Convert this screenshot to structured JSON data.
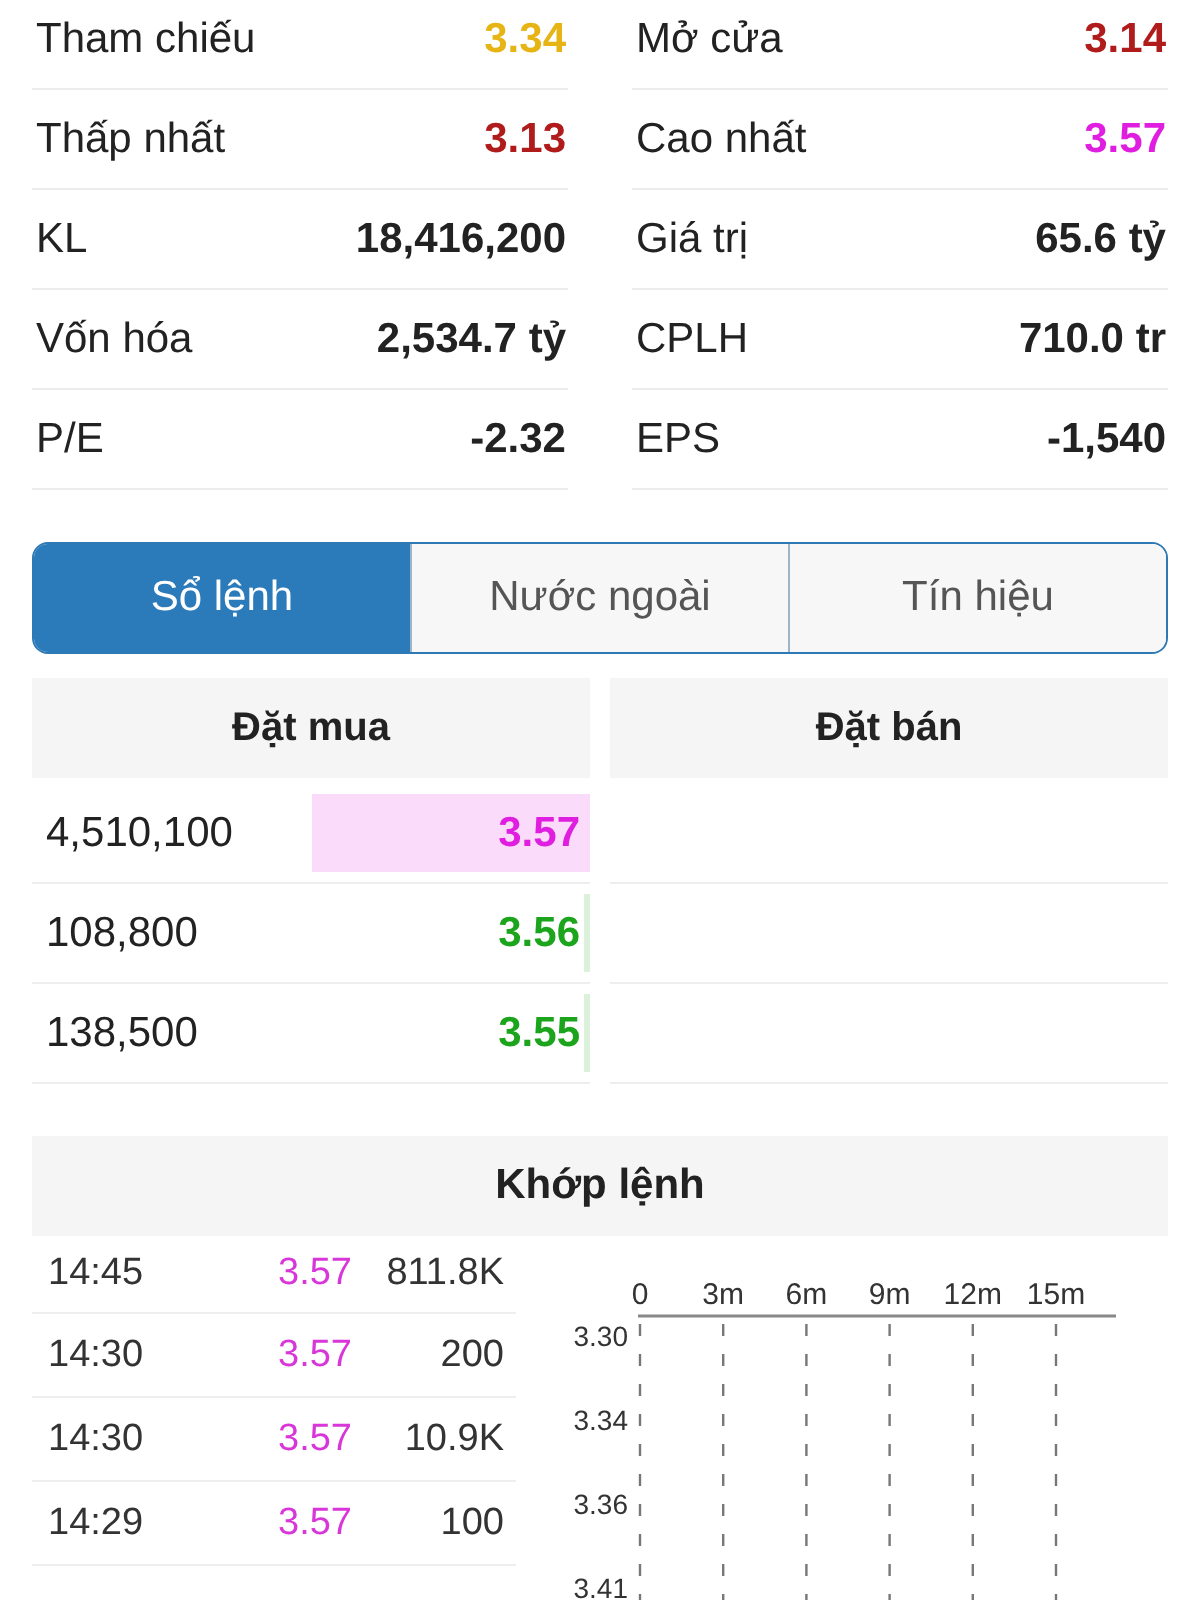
{
  "stats": [
    {
      "label": "Tham chiếu",
      "value": "3.34",
      "color": "#e6b414"
    },
    {
      "label": "Mở cửa",
      "value": "3.14",
      "color": "#b01c1c"
    },
    {
      "label": "Thấp nhất",
      "value": "3.13",
      "color": "#b01c1c"
    },
    {
      "label": "Cao nhất",
      "value": "3.57",
      "color": "#e01ee0"
    },
    {
      "label": "KL",
      "value": "18,416,200"
    },
    {
      "label": "Giá trị",
      "value": "65.6 tỷ"
    },
    {
      "label": "Vốn hóa",
      "value": "2,534.7 tỷ"
    },
    {
      "label": "CPLH",
      "value": "710.0 tr"
    },
    {
      "label": "P/E",
      "value": "-2.32"
    },
    {
      "label": "EPS",
      "value": "-1,540"
    }
  ],
  "tabs": [
    {
      "label": "Sổ lệnh",
      "selected": true
    },
    {
      "label": "Nước ngoài",
      "selected": false
    },
    {
      "label": "Tín hiệu",
      "selected": false
    }
  ],
  "order_book": {
    "bid_header": "Đặt mua",
    "ask_header": "Đặt bán",
    "bids": [
      {
        "volume": "4,510,100",
        "price": "3.57",
        "color": "#e01ee0",
        "level": 0.5
      },
      {
        "volume": "108,800",
        "price": "3.56",
        "color": "#1ca51c",
        "level": 0.01
      },
      {
        "volume": "138,500",
        "price": "3.55",
        "color": "#1ca51c",
        "level": 0.01
      }
    ]
  },
  "matched": {
    "title": "Khớp lệnh",
    "trades": [
      {
        "time": "14:45",
        "price": "3.57",
        "volume": "811.8K",
        "color": "#d936d9"
      },
      {
        "time": "14:30",
        "price": "3.57",
        "volume": "200",
        "color": "#d936d9"
      },
      {
        "time": "14:30",
        "price": "3.57",
        "volume": "10.9K",
        "color": "#d936d9"
      },
      {
        "time": "14:29",
        "price": "3.57",
        "volume": "100",
        "color": "#d936d9"
      }
    ],
    "chart": {
      "x_ticks": [
        "0",
        "3m",
        "6m",
        "9m",
        "12m",
        "15m"
      ],
      "y_ticks": [
        "3.30",
        "3.34",
        "3.36",
        "3.41"
      ]
    }
  }
}
